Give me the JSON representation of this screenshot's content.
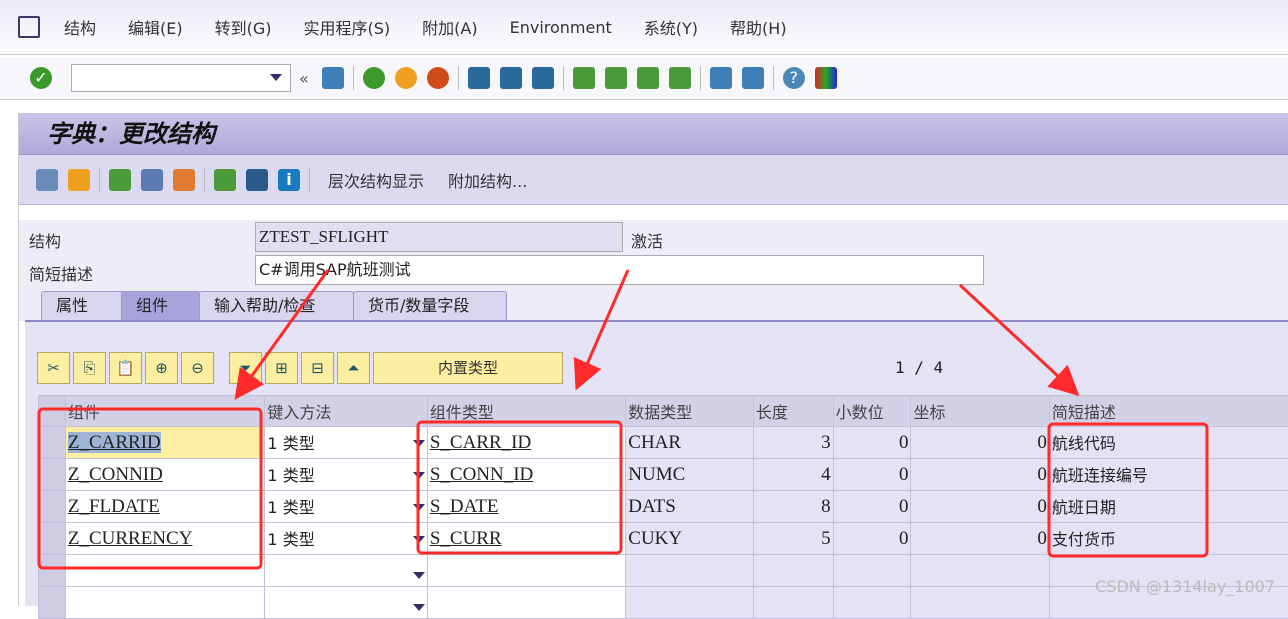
{
  "menu": [
    "结构",
    "编辑(E)",
    "转到(G)",
    "实用程序(S)",
    "附加(A)",
    "Environment",
    "系统(Y)",
    "帮助(H)"
  ],
  "command_field": {
    "value": ""
  },
  "title": "字典：更改结构",
  "app_toolbar": {
    "hierarchy": "层次结构显示",
    "append": "附加结构..."
  },
  "fields": {
    "structure_label": "结构",
    "structure_value": "ZTEST_SFLIGHT",
    "status": "激活",
    "desc_label": "简短描述",
    "desc_value": "C#调用SAP航班测试"
  },
  "tabs": [
    "属性",
    "组件",
    "输入帮助/检查",
    "货币/数量字段"
  ],
  "active_tab": "组件",
  "grid_toolbar": {
    "builtin_type": "内置类型"
  },
  "pager": "1 / 4",
  "columns": [
    "组件",
    "键入方法",
    "组件类型",
    "数据类型",
    "长度",
    "小数位",
    "坐标",
    "简短描述"
  ],
  "rows": [
    {
      "component": "Z_CARRID",
      "typing": "1 类型",
      "type": "S_CARR_ID",
      "dtype": "CHAR",
      "length": "3",
      "decimals": "0",
      "coord": "0",
      "desc": "航线代码"
    },
    {
      "component": "Z_CONNID",
      "typing": "1 类型",
      "type": "S_CONN_ID",
      "dtype": "NUMC",
      "length": "4",
      "decimals": "0",
      "coord": "0",
      "desc": "航班连接编号"
    },
    {
      "component": "Z_FLDATE",
      "typing": "1 类型",
      "type": "S_DATE",
      "dtype": "DATS",
      "length": "8",
      "decimals": "0",
      "coord": "0",
      "desc": "航班日期"
    },
    {
      "component": "Z_CURRENCY",
      "typing": "1 类型",
      "type": "S_CURR",
      "dtype": "CUKY",
      "length": "5",
      "decimals": "0",
      "coord": "0",
      "desc": "支付货币"
    }
  ],
  "watermark": "CSDN @1314lay_1007",
  "colors": {
    "annotation": "#ff2a2a",
    "title_bar": "#aea9d8",
    "selected_cell": "#fcefa2"
  }
}
